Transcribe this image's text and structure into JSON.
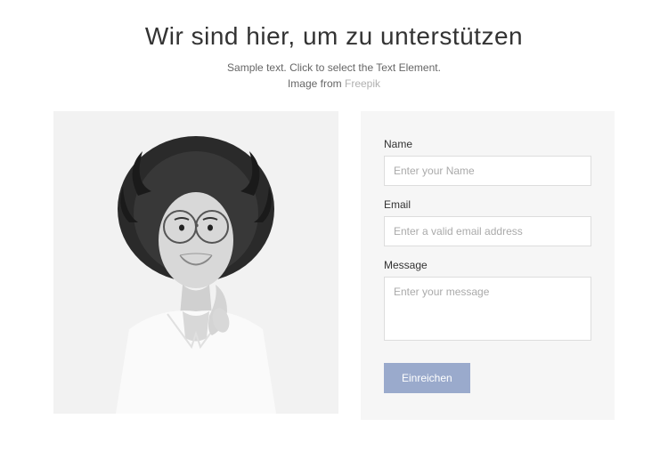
{
  "header": {
    "title": "Wir sind hier, um zu unterstützen",
    "subtitle_line1": "Sample text. Click to select the Text Element.",
    "subtitle_line2_prefix": "Image from ",
    "subtitle_link": "Freepik"
  },
  "form": {
    "name_label": "Name",
    "name_placeholder": "Enter your Name",
    "email_label": "Email",
    "email_placeholder": "Enter a valid email address",
    "message_label": "Message",
    "message_placeholder": "Enter your message",
    "submit_label": "Einreichen"
  },
  "colors": {
    "button_bg": "#9aaacc",
    "panel_bg": "#f6f6f6"
  }
}
